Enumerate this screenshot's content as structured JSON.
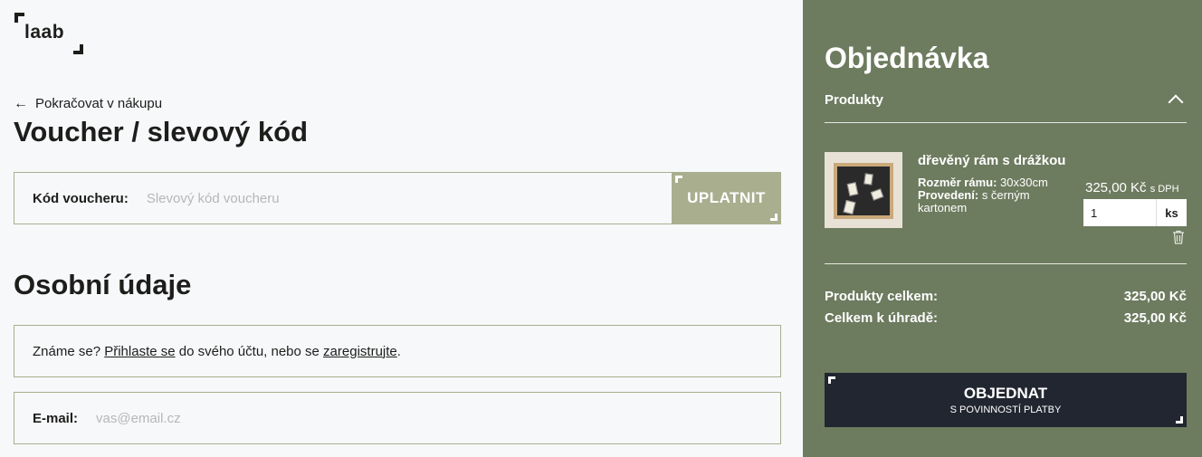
{
  "logo": {
    "text": "laab"
  },
  "left": {
    "back_link": "Pokračovat v nákupu",
    "voucher_title": "Voucher / slevový kód",
    "voucher": {
      "label": "Kód voucheru:",
      "placeholder": "Slevový kód voucheru",
      "apply_label": "UPLATNIT"
    },
    "personal_title": "Osobní údaje",
    "login_prompt": {
      "prefix": "Známe se? ",
      "login_link": "Přihlaste se",
      "middle": " do svého účtu, nebo se ",
      "register_link": "zaregistrujte",
      "suffix": "."
    },
    "email": {
      "label": "E-mail:",
      "placeholder": "vas@email.cz"
    }
  },
  "order": {
    "title": "Objednávka",
    "products_label": "Produkty",
    "product": {
      "name": "dřevěný rám s drážkou",
      "size_label": "Rozměr rámu:",
      "size_value": "30x30cm",
      "variant_label": "Provedení:",
      "variant_value": "s černým kartonem",
      "price": "325,00 Kč",
      "price_suffix": "s DPH",
      "quantity": "1",
      "unit": "ks"
    },
    "summary": {
      "products_total_label": "Produkty celkem:",
      "products_total_value": "325,00 Kč",
      "to_pay_label": "Celkem k úhradě:",
      "to_pay_value": "325,00 Kč"
    },
    "submit": {
      "label": "OBJEDNAT",
      "sublabel": "S POVINNOSTÍ PLATBY"
    }
  },
  "colors": {
    "panel": "#6d7b5f",
    "accent": "#a9ae8f",
    "button_dark": "#222630",
    "text": "#1d1d1b"
  }
}
